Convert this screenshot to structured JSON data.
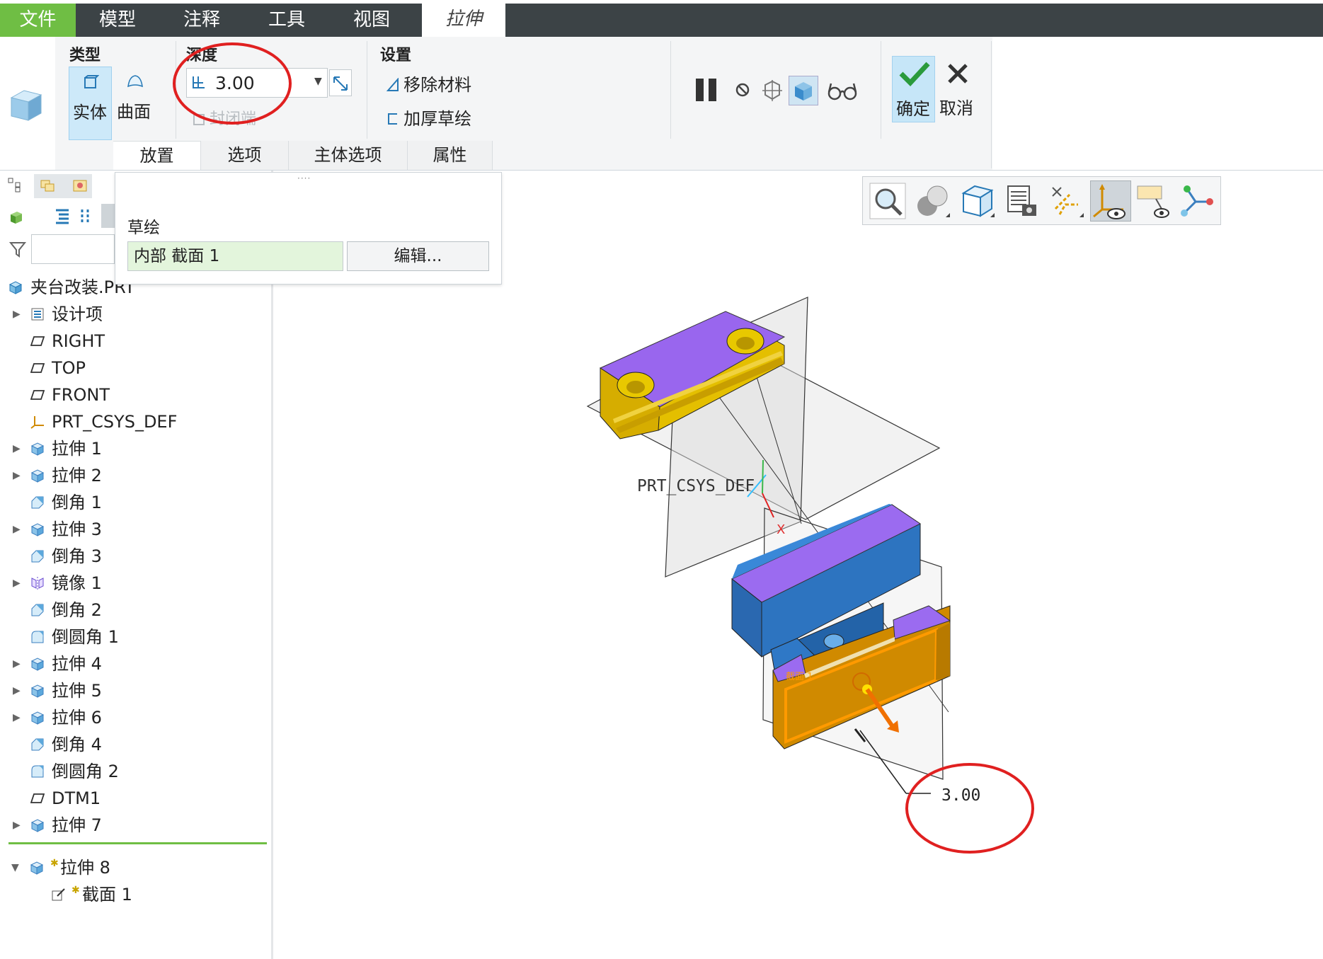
{
  "menu_tabs": {
    "file": "文件",
    "model": "模型",
    "annotate": "注释",
    "tools": "工具",
    "view": "视图",
    "extrude": "拉伸"
  },
  "ribbon": {
    "type_group": {
      "title": "类型",
      "solid": "实体",
      "surface": "曲面"
    },
    "depth_group": {
      "title": "深度",
      "value": "3.00",
      "capped": "封闭端"
    },
    "settings_group": {
      "title": "设置",
      "remove_material": "移除材料",
      "thicken": "加厚草绘"
    },
    "confirm": "确定",
    "cancel": "取消",
    "sub_tabs": [
      "放置",
      "选项",
      "主体选项",
      "属性"
    ]
  },
  "placement_panel": {
    "section_label": "草绘",
    "section_value": "内部 截面 1",
    "edit_button": "编辑..."
  },
  "model_tree": {
    "root": "夹台改装.PRT",
    "items": [
      {
        "label": "设计项",
        "expand": true,
        "icon": "design-items"
      },
      {
        "label": "RIGHT",
        "expand": false,
        "icon": "plane"
      },
      {
        "label": "TOP",
        "expand": false,
        "icon": "plane"
      },
      {
        "label": "FRONT",
        "expand": false,
        "icon": "plane"
      },
      {
        "label": "PRT_CSYS_DEF",
        "expand": false,
        "icon": "csys"
      },
      {
        "label": "拉伸 1",
        "expand": true,
        "icon": "extrude"
      },
      {
        "label": "拉伸 2",
        "expand": true,
        "icon": "extrude"
      },
      {
        "label": "倒角 1",
        "expand": false,
        "icon": "chamfer"
      },
      {
        "label": "拉伸 3",
        "expand": true,
        "icon": "extrude"
      },
      {
        "label": "倒角 3",
        "expand": false,
        "icon": "chamfer"
      },
      {
        "label": "镜像 1",
        "expand": true,
        "icon": "mirror"
      },
      {
        "label": "倒角 2",
        "expand": false,
        "icon": "chamfer"
      },
      {
        "label": "倒圆角 1",
        "expand": false,
        "icon": "round"
      },
      {
        "label": "拉伸 4",
        "expand": true,
        "icon": "extrude"
      },
      {
        "label": "拉伸 5",
        "expand": true,
        "icon": "extrude"
      },
      {
        "label": "拉伸 6",
        "expand": true,
        "icon": "extrude"
      },
      {
        "label": "倒角 4",
        "expand": false,
        "icon": "chamfer"
      },
      {
        "label": "倒圆角 2",
        "expand": false,
        "icon": "round"
      },
      {
        "label": "DTM1",
        "expand": false,
        "icon": "plane"
      },
      {
        "label": "拉伸 7",
        "expand": true,
        "icon": "extrude"
      }
    ],
    "active_feature": "拉伸 8",
    "active_child": "截面 1"
  },
  "viewport": {
    "csys_label": "PRT_CSYS_DEF",
    "axis_x": "X",
    "dimension": "3.00"
  },
  "colors": {
    "accent_green": "#6fbe44",
    "menubar": "#3c4346",
    "purple_face": "#9b6cf0",
    "yellow_face": "#e5c000",
    "blue_face": "#2e7fd0",
    "orange_face": "#d89400",
    "highlight_circle": "#e02020"
  }
}
